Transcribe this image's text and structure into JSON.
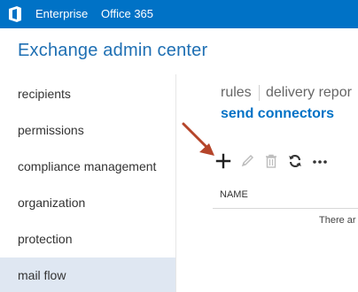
{
  "topbar": {
    "logo_icon": "office-logo-icon",
    "links": [
      "Enterprise",
      "Office 365"
    ],
    "background": "#0072c6"
  },
  "app": {
    "title": "Exchange admin center"
  },
  "sidebar": {
    "items": [
      {
        "label": "recipients"
      },
      {
        "label": "permissions"
      },
      {
        "label": "compliance management"
      },
      {
        "label": "organization"
      },
      {
        "label": "protection"
      },
      {
        "label": "mail flow",
        "active": true
      }
    ]
  },
  "tabs": {
    "items": [
      "rules",
      "delivery repor"
    ],
    "active": "send connectors"
  },
  "toolbar": {
    "icons": [
      "add-icon",
      "edit-icon",
      "delete-icon",
      "refresh-icon",
      "more-icon"
    ]
  },
  "grid": {
    "columns": [
      "NAME"
    ],
    "empty_message": "There ar"
  },
  "annotation": {
    "arrow_color": "#b5452a"
  }
}
